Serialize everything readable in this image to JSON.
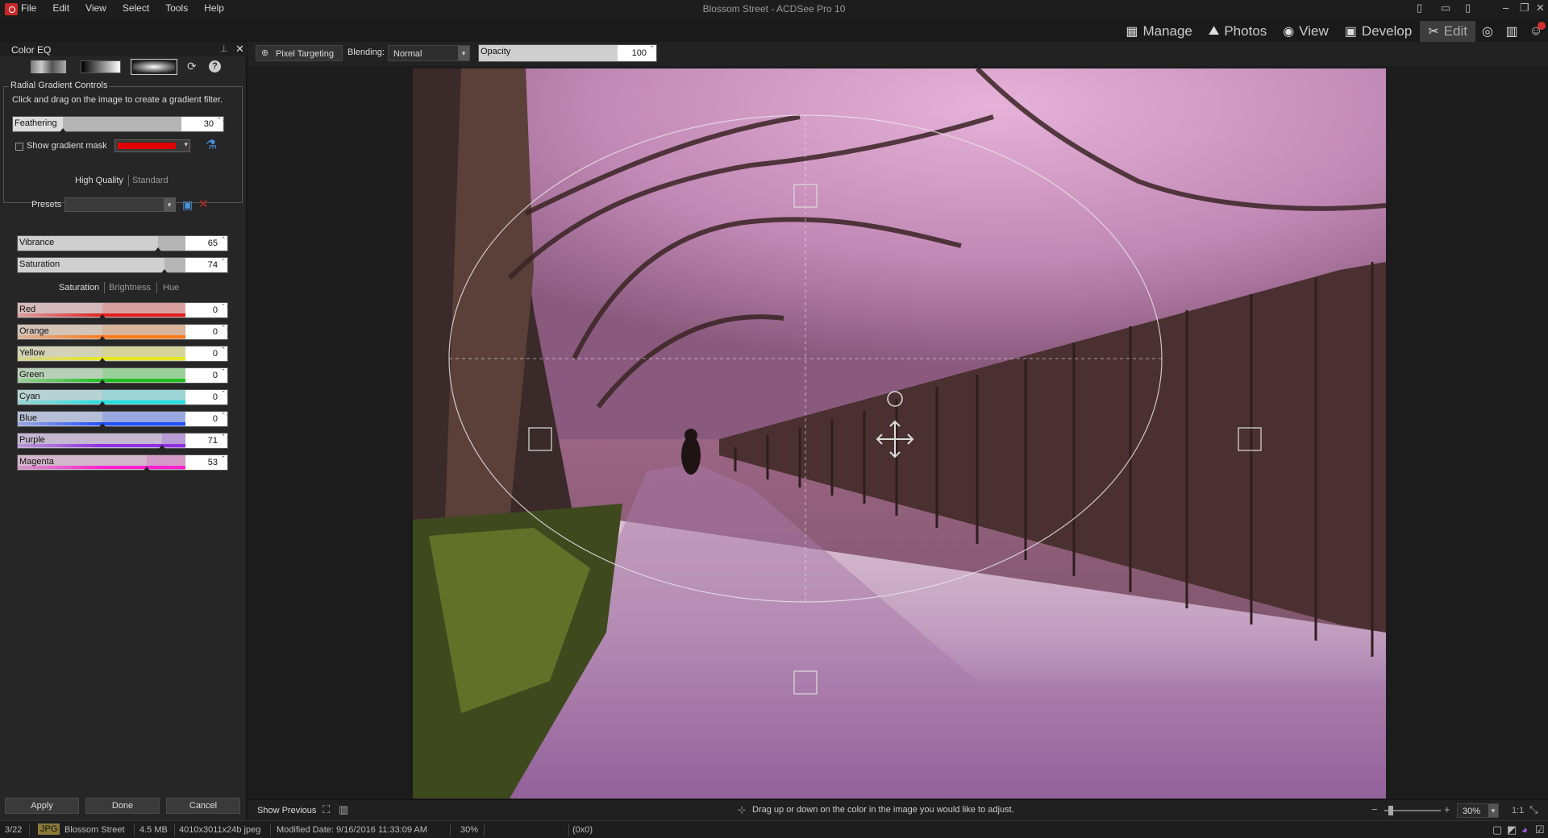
{
  "window": {
    "title": "Blossom Street - ACDSee Pro 10"
  },
  "menu": [
    "File",
    "Edit",
    "View",
    "Select",
    "Tools",
    "Help"
  ],
  "modes": [
    {
      "label": "Manage",
      "icon": "grid-icon"
    },
    {
      "label": "Photos",
      "icon": "photos-icon"
    },
    {
      "label": "View",
      "icon": "eye-icon"
    },
    {
      "label": "Develop",
      "icon": "develop-icon"
    },
    {
      "label": "Edit",
      "icon": "edit-icon",
      "active": true
    }
  ],
  "panel": {
    "title": "Color EQ",
    "radial_group_title": "Radial Gradient Controls",
    "instructions": "Click and drag on the image to create a gradient filter.",
    "feathering": {
      "label": "Feathering",
      "value": "30",
      "level": 0.5
    },
    "show_mask_label": "Show gradient mask",
    "mask_color": "#e00000",
    "quality": {
      "high": "High Quality",
      "standard": "Standard"
    },
    "presets_label": "Presets",
    "vibrance": {
      "label": "Vibrance",
      "value": "65",
      "level": 0.82
    },
    "saturation": {
      "label": "Saturation",
      "value": "74",
      "level": 0.87
    },
    "tabs": {
      "saturation": "Saturation",
      "brightness": "Brightness",
      "hue": "Hue"
    },
    "colors": [
      {
        "label": "Red",
        "value": "0",
        "level": 0.5,
        "color": "#e02020",
        "tint": "#d9a0a0"
      },
      {
        "label": "Orange",
        "value": "0",
        "level": 0.5,
        "color": "#ff7a1a",
        "tint": "#d9b39a"
      },
      {
        "label": "Yellow",
        "value": "0",
        "level": 0.5,
        "color": "#e8e820",
        "tint": "#d4d49a"
      },
      {
        "label": "Green",
        "value": "0",
        "level": 0.5,
        "color": "#20c020",
        "tint": "#9ad09a"
      },
      {
        "label": "Cyan",
        "value": "0",
        "level": 0.5,
        "color": "#20e0e0",
        "tint": "#9ad4d4"
      },
      {
        "label": "Blue",
        "value": "0",
        "level": 0.5,
        "color": "#2050ff",
        "tint": "#9aa8e0"
      },
      {
        "label": "Purple",
        "value": "71",
        "level": 0.85,
        "color": "#9030e0",
        "tint": "#b89ad4"
      },
      {
        "label": "Magenta",
        "value": "53",
        "level": 0.76,
        "color": "#ff20d0",
        "tint": "#d49ac8"
      }
    ],
    "buttons": {
      "apply": "Apply",
      "done": "Done",
      "cancel": "Cancel"
    }
  },
  "toolbar": {
    "pixel_targeting": "Pixel Targeting",
    "blending_label": "Blending:",
    "blending_value": "Normal",
    "opacity_label": "Opacity",
    "opacity_value": "100"
  },
  "status": {
    "show_previous": "Show Previous",
    "hint": "Drag up or down on the color in the image you would like to adjust.",
    "zoom": "30%",
    "ratio": "1:1"
  },
  "footer": {
    "position": "3/22",
    "format": "JPG",
    "filename": "Blossom Street",
    "size": "4.5 MB",
    "dims": "4010x3011x24b jpeg",
    "modified": "Modified Date: 9/16/2016 11:33:09 AM",
    "zoom": "30%",
    "coords": "(0x0)"
  }
}
